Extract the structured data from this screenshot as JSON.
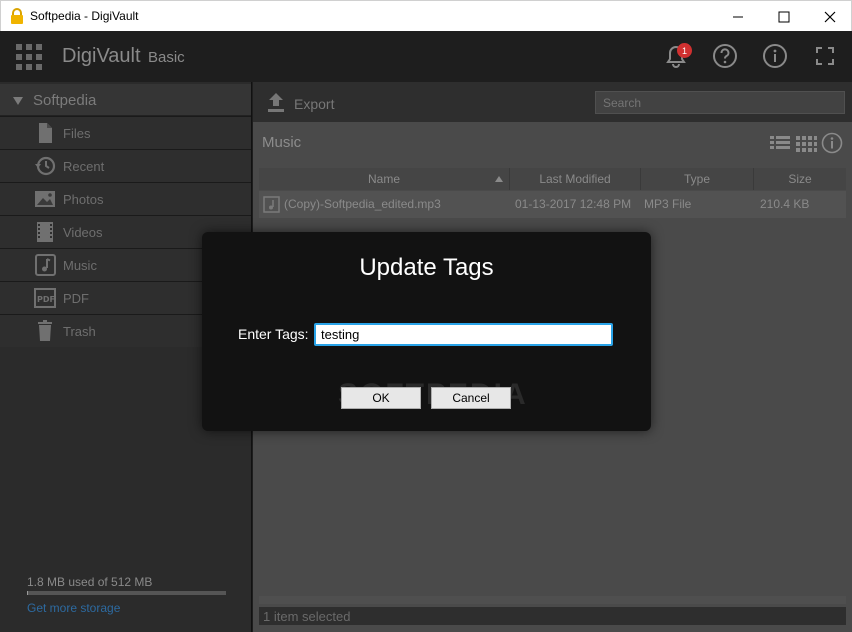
{
  "window": {
    "title": "Softpedia - DigiVault",
    "controls": {
      "minimize": "─",
      "maximize": "☐",
      "close": "✕"
    }
  },
  "header": {
    "app_name": "DigiVault",
    "edition": "Basic",
    "notification_count": "1"
  },
  "sidebar": {
    "root_label": "Softpedia",
    "items": [
      {
        "label": "Files",
        "icon": "file-icon"
      },
      {
        "label": "Recent",
        "icon": "history-icon"
      },
      {
        "label": "Photos",
        "icon": "image-icon"
      },
      {
        "label": "Videos",
        "icon": "film-icon"
      },
      {
        "label": "Music",
        "icon": "music-icon"
      },
      {
        "label": "PDF",
        "icon": "pdf-icon"
      },
      {
        "label": "Trash",
        "icon": "trash-icon"
      }
    ],
    "storage_text": "1.8 MB used of 512 MB",
    "storage_used_fraction": 0.0035,
    "storage_link": "Get more storage"
  },
  "toolbar": {
    "export_label": "Export",
    "search_placeholder": "Search"
  },
  "main": {
    "folder_title": "Music",
    "columns": {
      "name": "Name",
      "modified": "Last Modified",
      "type": "Type",
      "size": "Size"
    },
    "rows": [
      {
        "name": "(Copy)-Softpedia_edited.mp3",
        "modified": "01-13-2017 12:48 PM",
        "type": "MP3 File",
        "size": "210.4 KB"
      }
    ],
    "status": "1 item selected"
  },
  "dialog": {
    "title": "Update Tags",
    "label": "Enter Tags:",
    "input_value": "testing",
    "ok_label": "OK",
    "cancel_label": "Cancel",
    "watermark": "SOFTPEDIA"
  },
  "colors": {
    "accent_focus": "#29a3e8",
    "badge": "#d03030",
    "link": "#2d6aa0"
  }
}
